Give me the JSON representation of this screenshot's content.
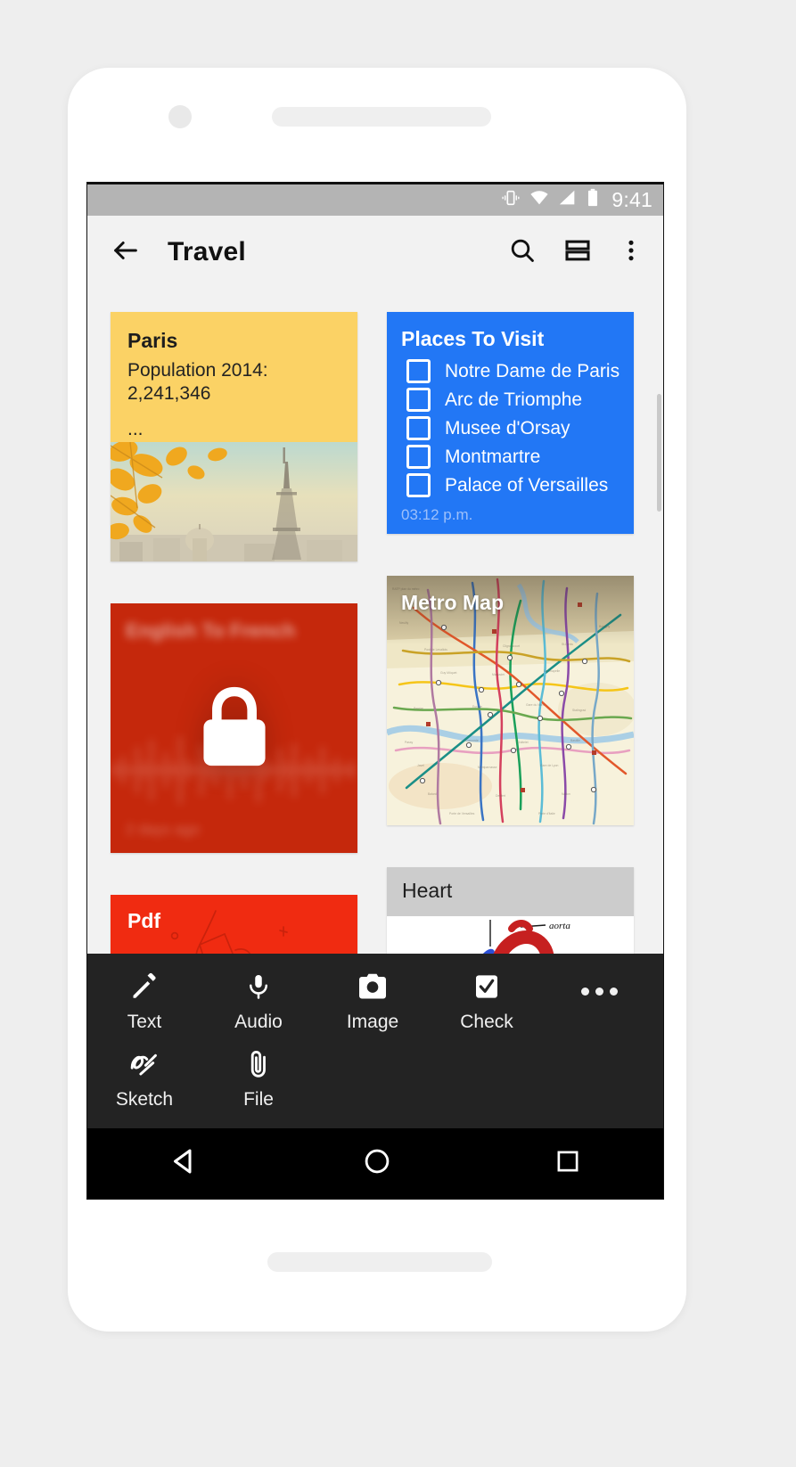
{
  "status_bar": {
    "time": "9:41",
    "icons": [
      "vibrate-icon",
      "wifi-icon",
      "signal-icon",
      "battery-icon"
    ]
  },
  "app_bar": {
    "title": "Travel",
    "back_icon": "back-arrow-icon",
    "search_icon": "search-icon",
    "view_icon": "list-view-icon",
    "overflow_icon": "overflow-menu-icon"
  },
  "notes": {
    "paris": {
      "title": "Paris",
      "text": "Population 2014: 2,241,346",
      "ellipsis": "...",
      "image": "eiffel-tower-photo"
    },
    "places": {
      "title": "Places To Visit",
      "items": [
        {
          "label": "Notre Dame de Paris",
          "checked": false
        },
        {
          "label": "Arc de Triomphe",
          "checked": false
        },
        {
          "label": "Musee d'Orsay",
          "checked": false
        },
        {
          "label": "Montmartre",
          "checked": false
        },
        {
          "label": "Palace of Versailles",
          "checked": false
        }
      ],
      "timestamp": "03:12 p.m.",
      "color": "#2277f5"
    },
    "audio": {
      "title": "English To French",
      "date": "2 days ago",
      "locked": true,
      "lock_icon": "lock-icon",
      "color": "#c5280c"
    },
    "metro": {
      "title": "Metro Map",
      "image": "paris-metro-map"
    },
    "pdf": {
      "title": "Pdf",
      "color": "#f02b11"
    },
    "heart": {
      "title": "Heart",
      "image": "heart-anatomy-sketch",
      "annotation": "aorta"
    }
  },
  "bottom_sheet": {
    "row1": [
      {
        "label": "Text",
        "icon": "pencil-icon"
      },
      {
        "label": "Audio",
        "icon": "microphone-icon"
      },
      {
        "label": "Image",
        "icon": "camera-icon"
      },
      {
        "label": "Check",
        "icon": "checkbox-icon"
      }
    ],
    "row2": [
      {
        "label": "Sketch",
        "icon": "scribble-icon"
      },
      {
        "label": "File",
        "icon": "paperclip-icon"
      }
    ],
    "more_icon": "more-horizontal-icon"
  },
  "nav_bar": {
    "back": "nav-back-triangle-icon",
    "home": "nav-home-circle-icon",
    "recents": "nav-recents-square-icon"
  }
}
